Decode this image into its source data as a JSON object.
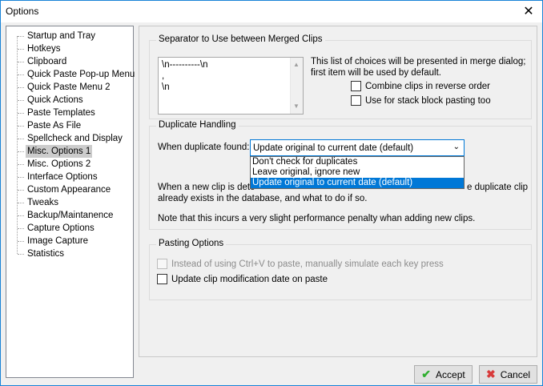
{
  "window": {
    "title": "Options",
    "close_glyph": "✕"
  },
  "tree": {
    "items": [
      {
        "label": "Startup and Tray"
      },
      {
        "label": "Hotkeys"
      },
      {
        "label": "Clipboard"
      },
      {
        "label": "Quick Paste Pop-up Menu"
      },
      {
        "label": "Quick Paste Menu 2"
      },
      {
        "label": "Quick Actions"
      },
      {
        "label": "Paste Templates"
      },
      {
        "label": "Paste As File"
      },
      {
        "label": "Spellcheck and Display"
      },
      {
        "label": "Misc. Options 1",
        "selected": true
      },
      {
        "label": "Misc. Options 2"
      },
      {
        "label": "Interface Options"
      },
      {
        "label": "Custom Appearance"
      },
      {
        "label": "Tweaks"
      },
      {
        "label": "Backup/Maintanence"
      },
      {
        "label": "Capture Options"
      },
      {
        "label": "Image Capture"
      },
      {
        "label": "Statistics"
      }
    ]
  },
  "separator": {
    "title": "Separator to Use between Merged Clips",
    "list_lines": [
      "\\n----------\\n",
      ",",
      "\\n"
    ],
    "note_line1": "This list of choices will be presented in merge dialog;",
    "note_line2": "first item will be used by default.",
    "combine_reverse": "Combine clips in reverse order",
    "stack_block": "Use for stack block pasting too"
  },
  "duplicate": {
    "title": "Duplicate Handling",
    "label": "When duplicate found:",
    "selected": "Update original to current date (default)",
    "options": [
      "Don't check for duplicates",
      "Leave original, ignore new",
      "Update original to current date (default)"
    ],
    "desc_start": "When a new clip is dete",
    "desc_end": "e duplicate clip",
    "desc_line2": "already exists in the database, and what to do if so.",
    "perf_note": "Note that this incurs a very slight performance penalty whan adding new clips."
  },
  "pasting": {
    "title": "Pasting Options",
    "simulate": "Instead of using Ctrl+V to paste, manually simulate each key press",
    "update_date": "Update clip modification date on paste"
  },
  "buttons": {
    "accept": "Accept",
    "cancel": "Cancel"
  },
  "colors": {
    "accent": "#0078d7",
    "accept_icon": "#2fae2f",
    "cancel_icon": "#d83b3b"
  }
}
